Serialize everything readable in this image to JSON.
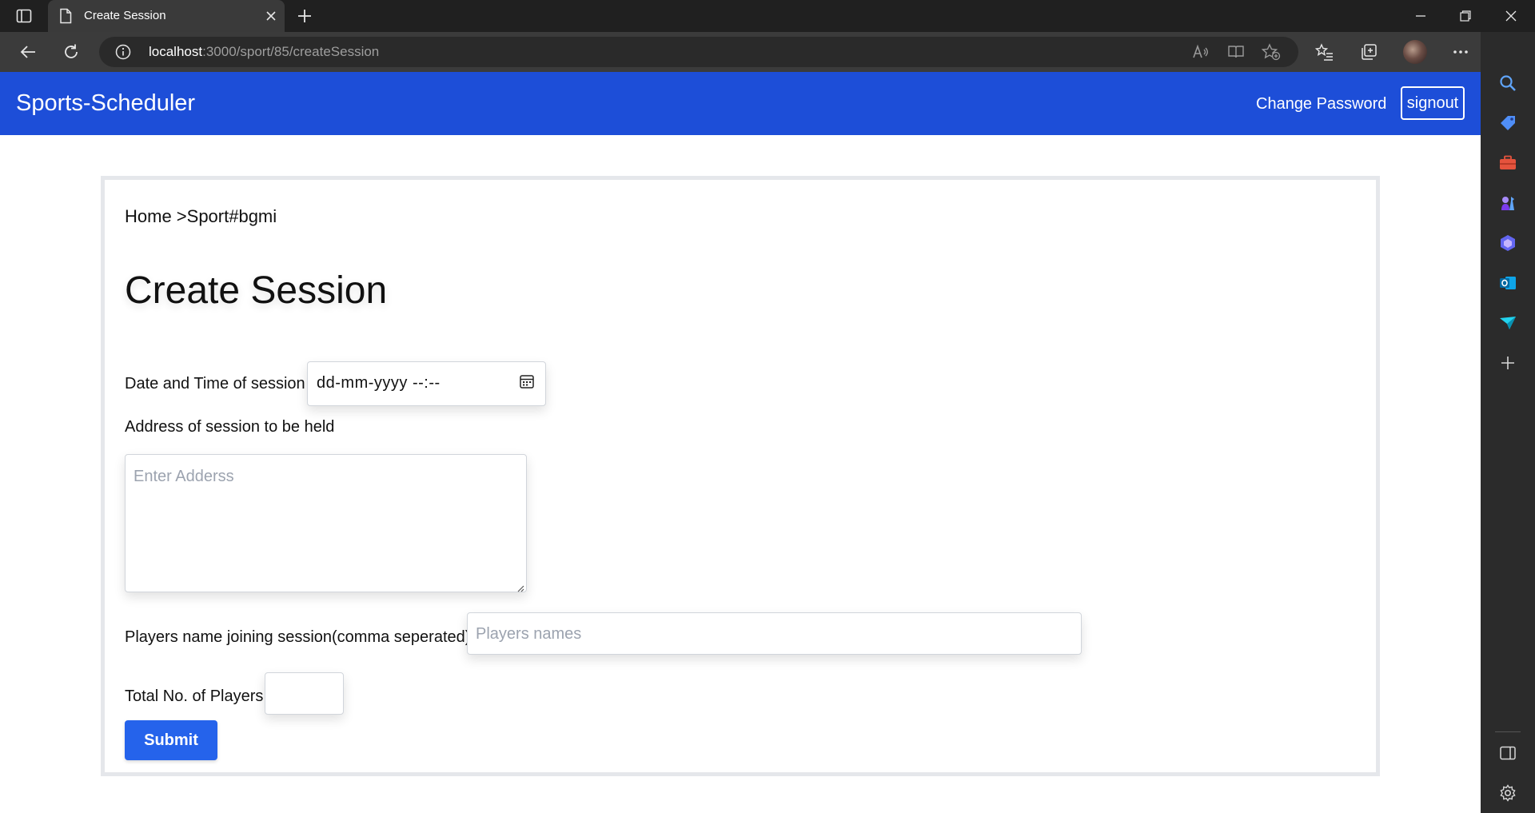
{
  "browser": {
    "tab_title": "Create Session",
    "url_host": "localhost",
    "url_path": ":3000/sport/85/createSession"
  },
  "navbar": {
    "brand": "Sports-Scheduler",
    "change_password": "Change Password",
    "signout": "signout",
    "color": "#1d4ed8"
  },
  "breadcrumb": "Home >Sport#bgmi",
  "page_title": "Create Session",
  "form": {
    "datetime_label": "Date and Time of session",
    "datetime_value": "dd-mm-yyyy  --:--",
    "address_label": "Address of session to be held",
    "address_placeholder": "Enter Adderss",
    "players_label": "Players name joining session(comma seperated)",
    "players_placeholder": "Players names",
    "total_label": "Total No. of Players",
    "total_value": "",
    "submit": "Submit",
    "submit_color": "#2563eb"
  },
  "icons": {
    "tab": "document-icon",
    "calendar": "calendar-icon"
  }
}
